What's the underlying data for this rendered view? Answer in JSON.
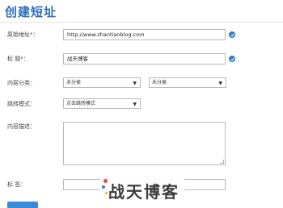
{
  "page": {
    "title": "创建短址"
  },
  "form": {
    "original_url": {
      "label": "原始地址*：",
      "value": "http://www.zhantianblog.com"
    },
    "title": {
      "label": "标  题*：",
      "value": "战天博客"
    },
    "category": {
      "label": "内容分类：",
      "select1": "未分类",
      "select2": "未分类"
    },
    "jump_mode": {
      "label": "跳转模式：",
      "value": "点击跳转模式"
    },
    "description": {
      "label": "内容描述：",
      "value": ""
    },
    "tags": {
      "label": "标  签：",
      "value": ""
    }
  },
  "watermark": {
    "text": "战天博客"
  },
  "colors": {
    "accent": "#2f6fb8",
    "info_icon": "#2f7fc8",
    "submit_button": "#3b8ad6"
  },
  "icons": {
    "field_info": "check-info-icon",
    "dropdown": "chevron-down-icon"
  }
}
